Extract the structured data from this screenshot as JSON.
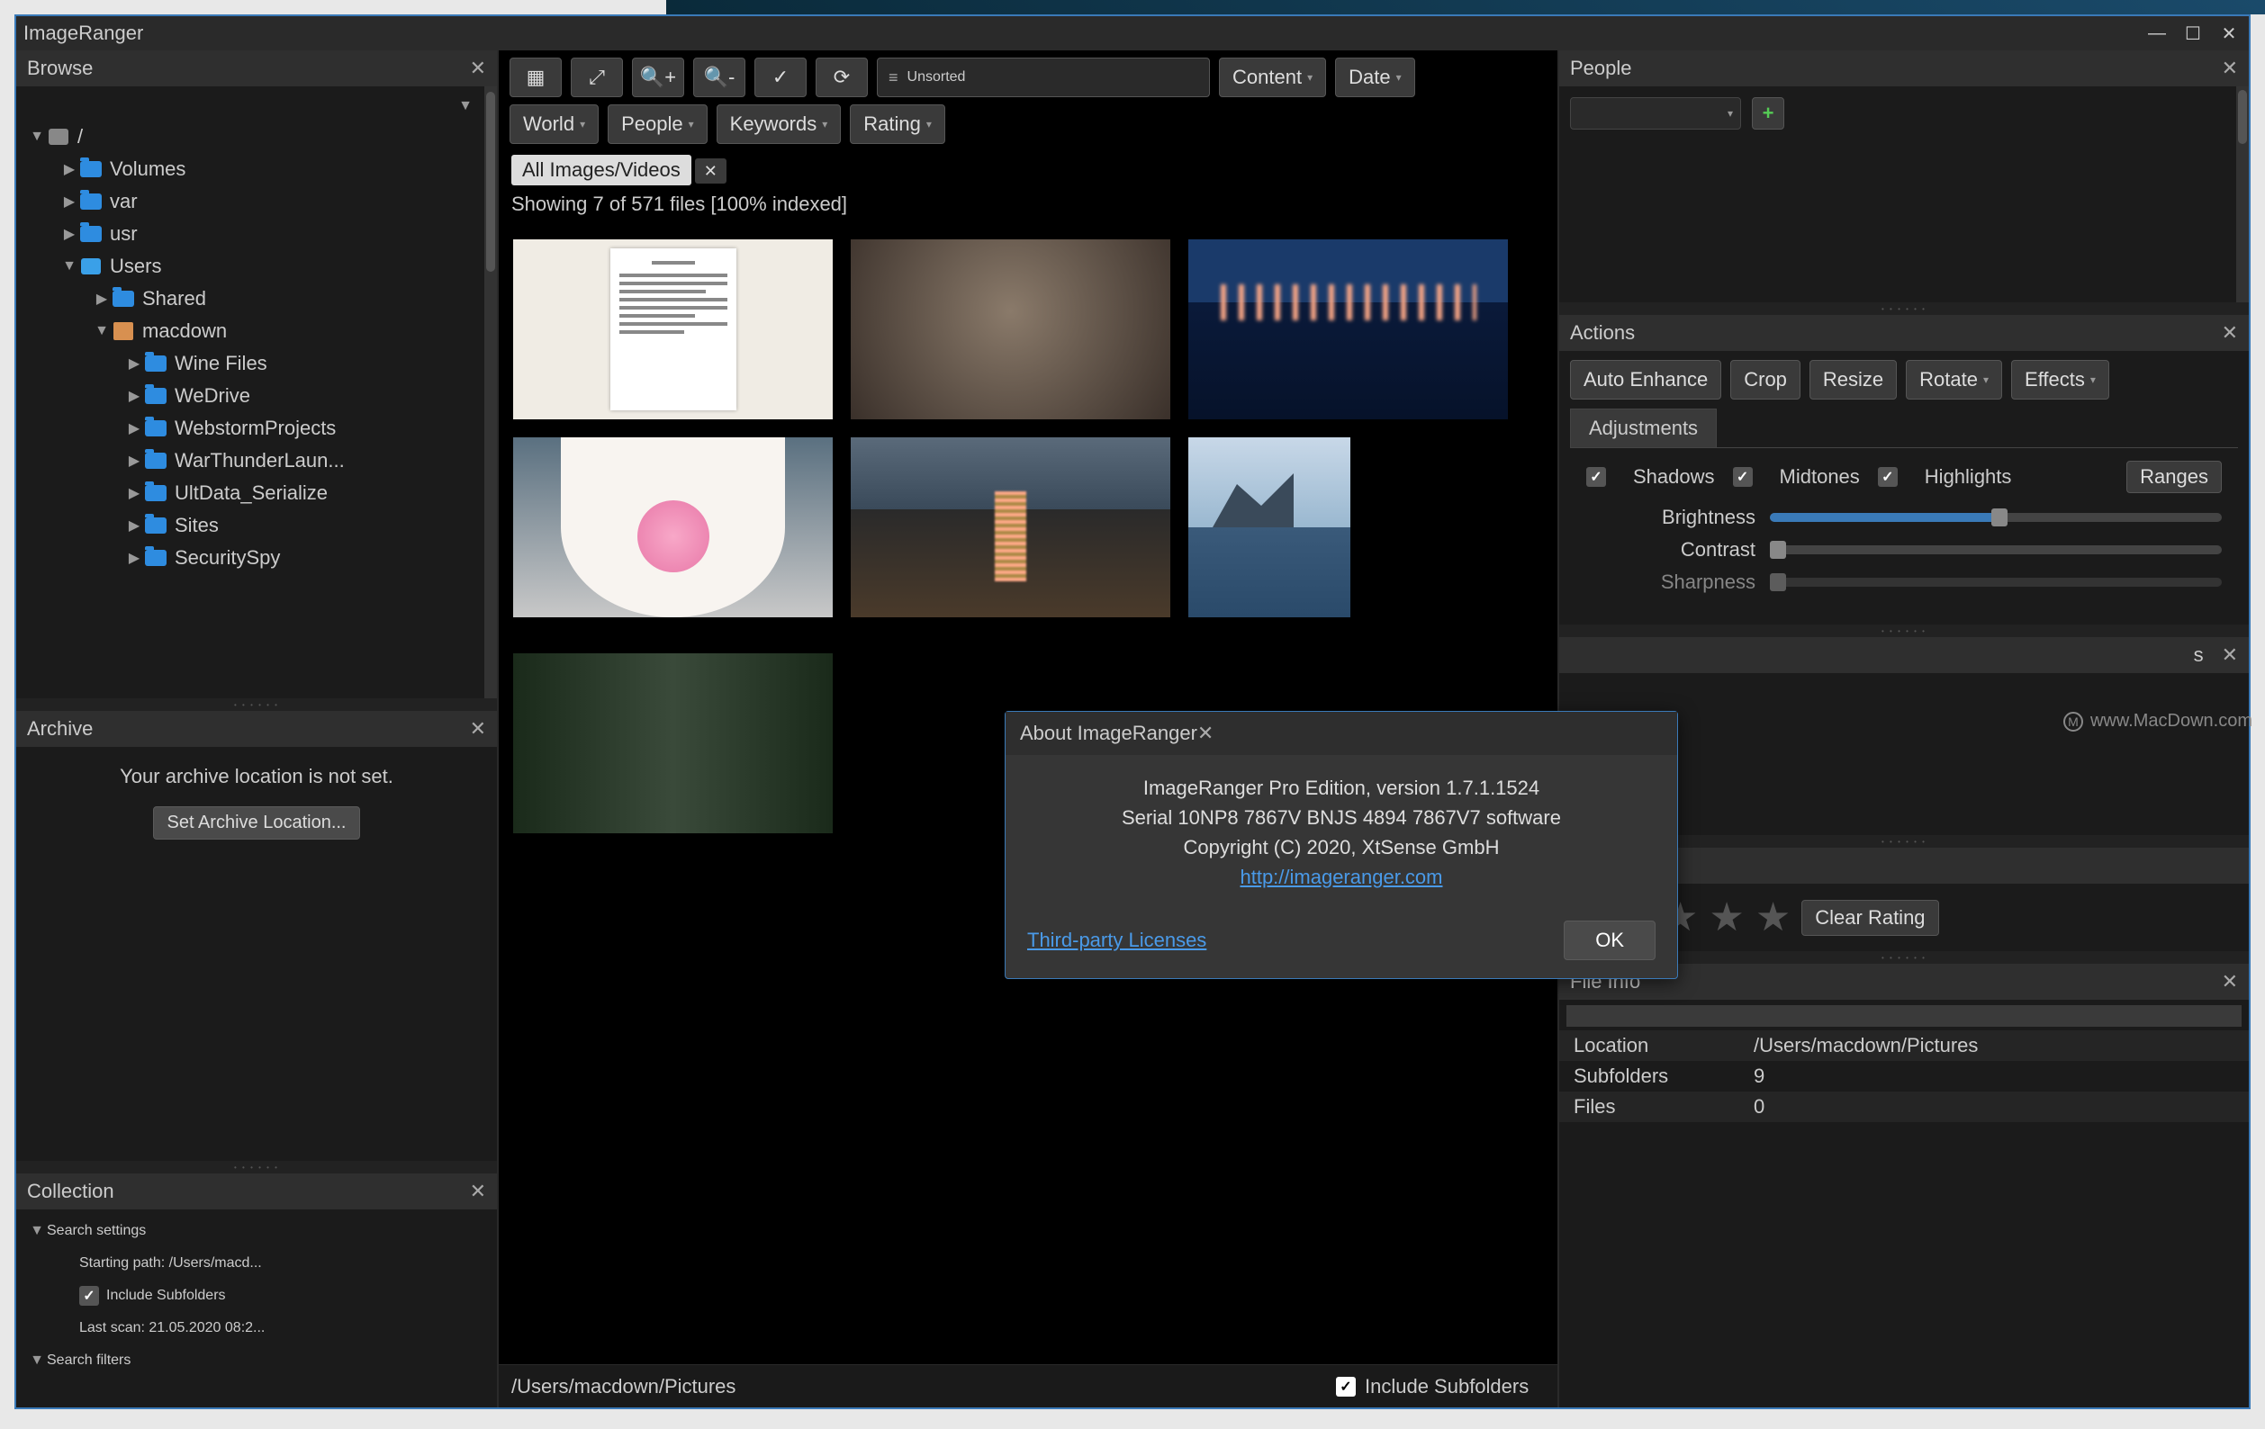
{
  "app": {
    "title": "ImageRanger"
  },
  "window_controls": {
    "minimize": "–",
    "maximize": "▢",
    "close": "✕"
  },
  "browse": {
    "title": "Browse",
    "tree": [
      {
        "indent": 0,
        "expand": "▼",
        "icon": "disk",
        "label": "/"
      },
      {
        "indent": 1,
        "expand": "▶",
        "icon": "folder",
        "label": "Volumes"
      },
      {
        "indent": 1,
        "expand": "▶",
        "icon": "folder",
        "label": "var"
      },
      {
        "indent": 1,
        "expand": "▶",
        "icon": "folder",
        "label": "usr"
      },
      {
        "indent": 1,
        "expand": "▼",
        "icon": "user",
        "label": "Users"
      },
      {
        "indent": 2,
        "expand": "▶",
        "icon": "folder",
        "label": "Shared"
      },
      {
        "indent": 2,
        "expand": "▼",
        "icon": "home",
        "label": "macdown"
      },
      {
        "indent": 3,
        "expand": "▶",
        "icon": "folder",
        "label": "Wine Files"
      },
      {
        "indent": 3,
        "expand": "▶",
        "icon": "folder",
        "label": "WeDrive"
      },
      {
        "indent": 3,
        "expand": "▶",
        "icon": "folder",
        "label": "WebstormProjects"
      },
      {
        "indent": 3,
        "expand": "▶",
        "icon": "folder",
        "label": "WarThunderLaun..."
      },
      {
        "indent": 3,
        "expand": "▶",
        "icon": "folder",
        "label": "UltData_Serialize"
      },
      {
        "indent": 3,
        "expand": "▶",
        "icon": "folder",
        "label": "Sites"
      },
      {
        "indent": 3,
        "expand": "▶",
        "icon": "folder",
        "label": "SecuritySpy"
      }
    ]
  },
  "archive": {
    "title": "Archive",
    "message": "Your archive location is not set.",
    "button": "Set Archive Location..."
  },
  "collection": {
    "title": "Collection",
    "items": [
      {
        "indent": 0,
        "expand": "▼",
        "label": "Search settings"
      },
      {
        "indent": 1,
        "expand": "",
        "label": "Starting path: /Users/macd..."
      },
      {
        "indent": 1,
        "expand": "",
        "checkbox": true,
        "label": "Include Subfolders"
      },
      {
        "indent": 1,
        "expand": "",
        "label": "Last scan: 21.05.2020 08:2..."
      },
      {
        "indent": 0,
        "expand": "▼",
        "label": "Search filters"
      }
    ]
  },
  "toolbar": {
    "sort_label": "Unsorted",
    "content_btn": "Content",
    "date_btn": "Date",
    "world_btn": "World",
    "people_btn": "People",
    "keywords_btn": "Keywords",
    "rating_btn": "Rating"
  },
  "filter_chip": {
    "label": "All Images/Videos"
  },
  "status": "Showing 7 of 571 files [100% indexed]",
  "pathbar": {
    "path": "/Users/macdown/Pictures",
    "include_label": "Include Subfolders"
  },
  "people": {
    "title": "People"
  },
  "actions": {
    "title": "Actions",
    "auto_enhance": "Auto Enhance",
    "crop": "Crop",
    "resize": "Resize",
    "rotate": "Rotate",
    "effects": "Effects",
    "adjustments_tab": "Adjustments",
    "shadows": "Shadows",
    "midtones": "Midtones",
    "highlights": "Highlights",
    "ranges": "Ranges",
    "brightness": "Brightness",
    "contrast": "Contrast",
    "sharpness": "Sharpness"
  },
  "hidden_panel": {
    "label_suffix": "s"
  },
  "rating": {
    "clear": "Clear Rating"
  },
  "fileinfo": {
    "title": "File Info",
    "rows": [
      {
        "k": "Location",
        "v": "/Users/macdown/Pictures"
      },
      {
        "k": "Subfolders",
        "v": "9"
      },
      {
        "k": "Files",
        "v": "0"
      }
    ]
  },
  "dialog": {
    "title": "About ImageRanger",
    "line1": "ImageRanger Pro Edition, version 1.7.1.1524",
    "line2": "Serial 10NP8 7867V BNJS 4894 7867V7 software",
    "line3": "Copyright (C) 2020, XtSense GmbH",
    "link": "http://imageranger.com",
    "third_party": "Third-party Licenses",
    "ok": "OK"
  },
  "watermark": "www.MacDown.com"
}
